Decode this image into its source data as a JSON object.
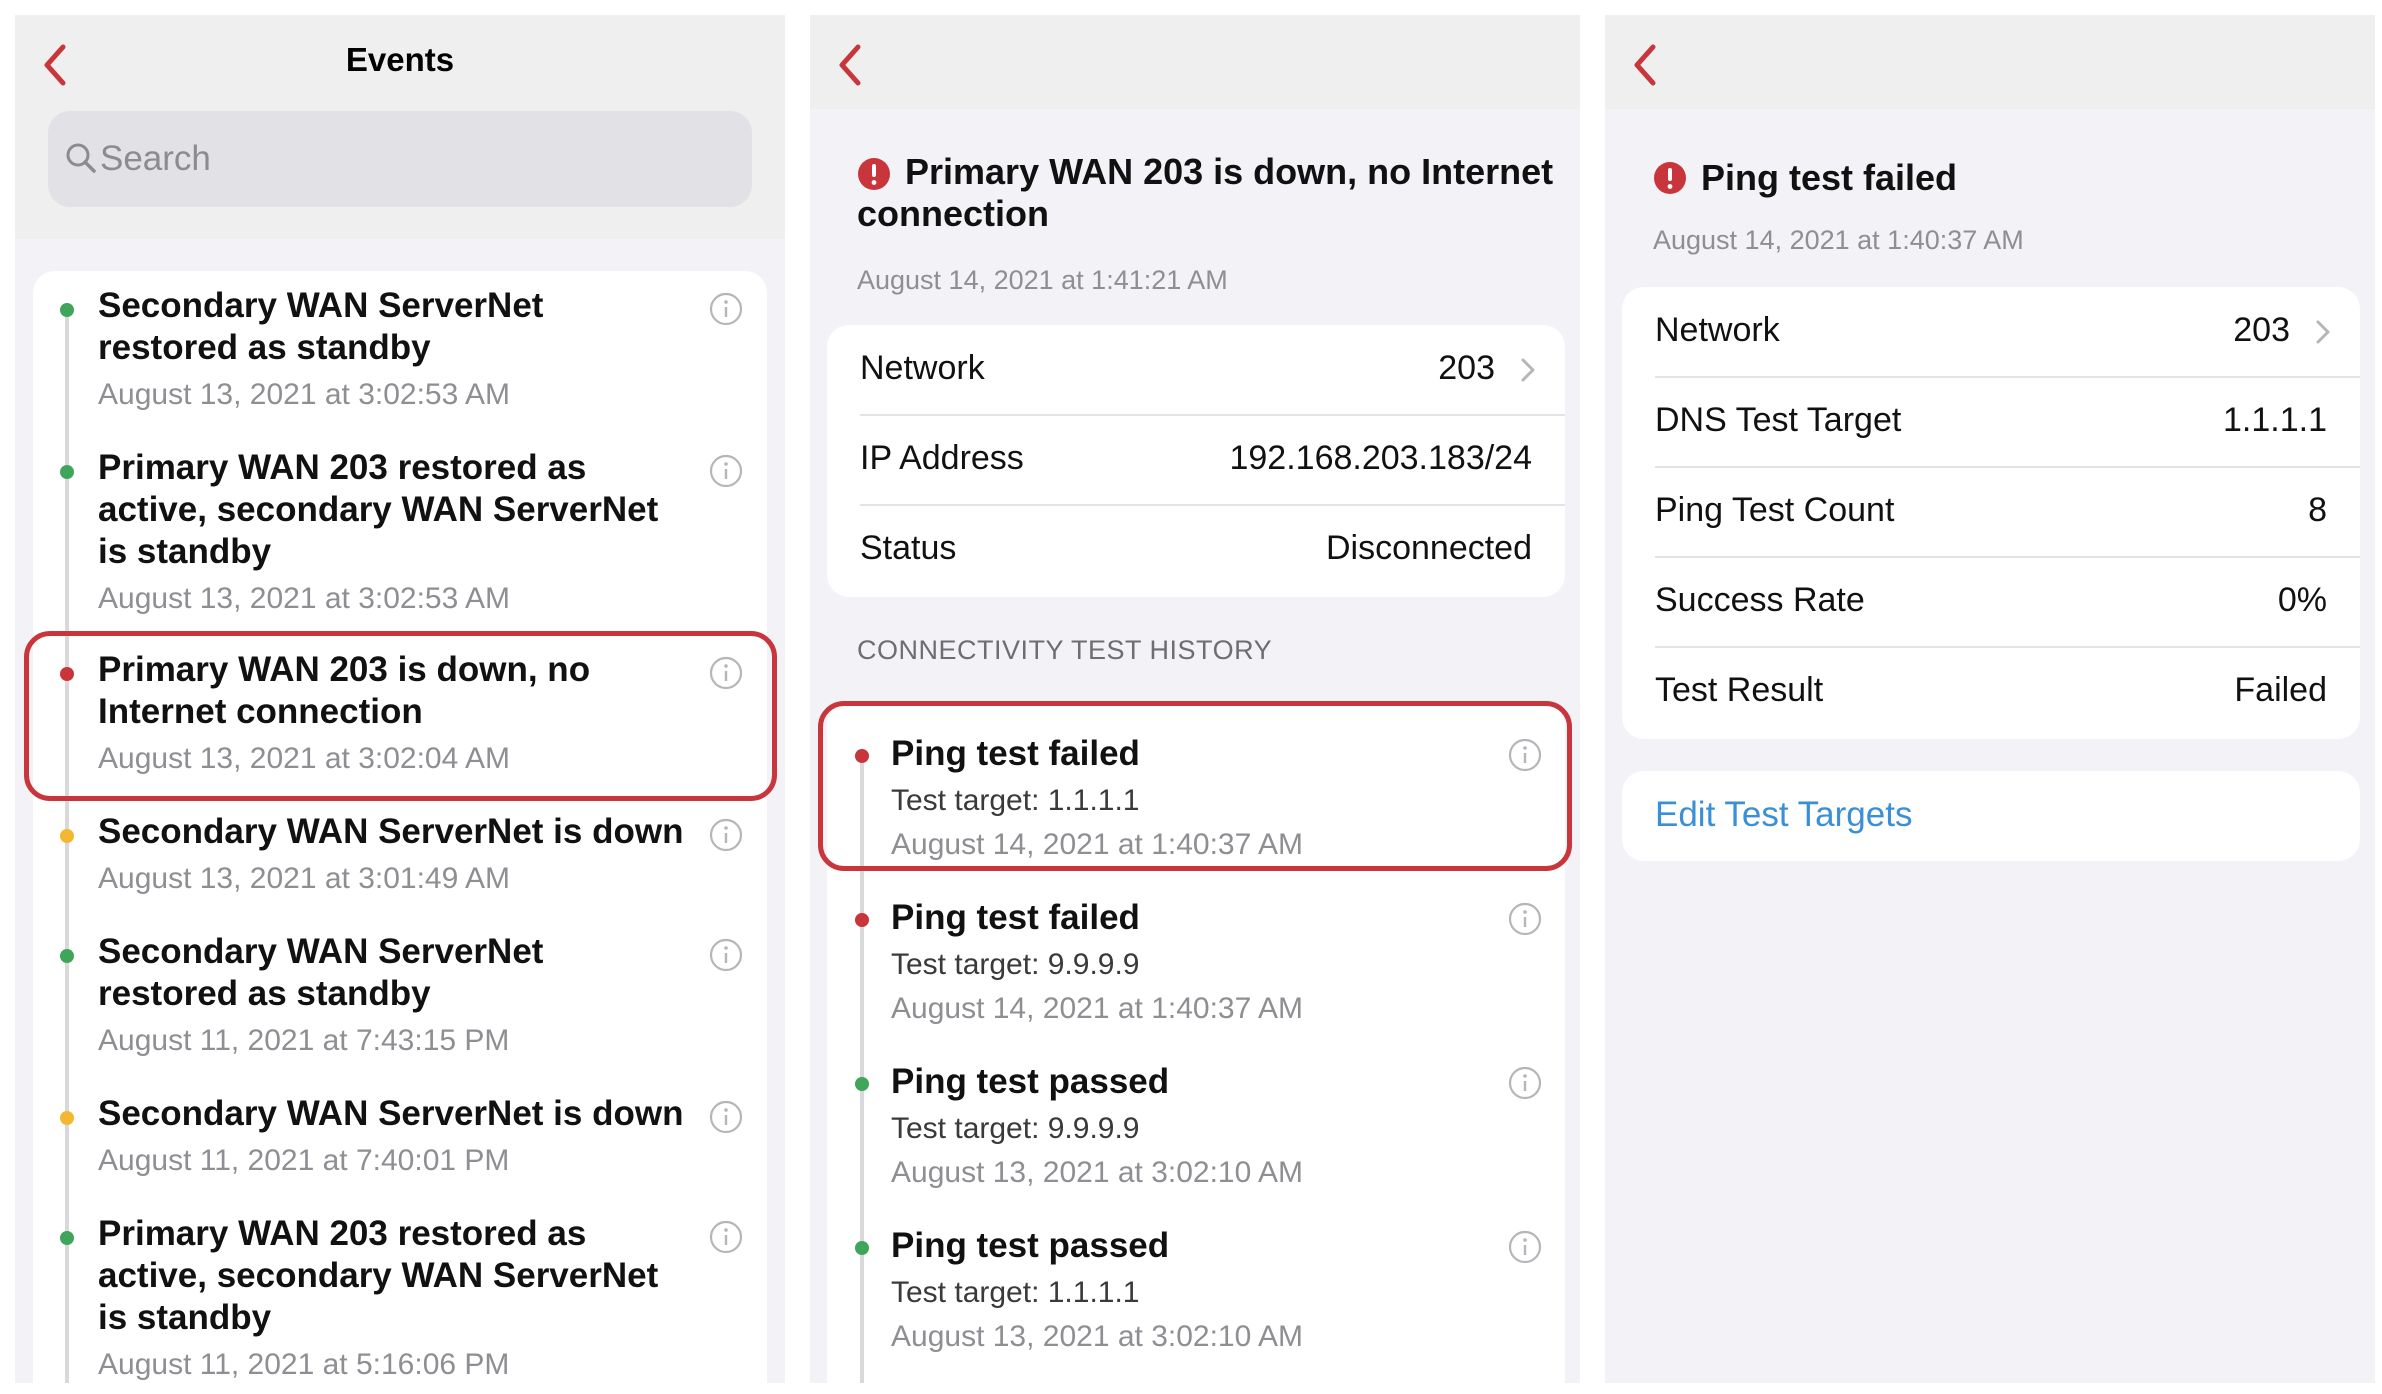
{
  "colors": {
    "accent_red": "#c8353a",
    "green": "#3fa55a",
    "yellow": "#f4b731",
    "link_blue": "#3b8fd6"
  },
  "events_screen": {
    "title": "Events",
    "search_placeholder": "Search",
    "events": [
      {
        "title_line1": "Secondary WAN ServerNet",
        "title_line2": "restored as standby",
        "title_line3": "",
        "time": "August 13, 2021 at 3:02:53 AM",
        "status": "green"
      },
      {
        "title_line1": "Primary WAN 203 restored as",
        "title_line2": "active, secondary WAN ServerNet",
        "title_line3": "is standby",
        "time": "August 13, 2021 at 3:02:53 AM",
        "status": "green"
      },
      {
        "title_line1": "Primary WAN 203 is down, no",
        "title_line2": "Internet connection",
        "title_line3": "",
        "time": "August 13, 2021 at 3:02:04 AM",
        "status": "red",
        "highlighted": true
      },
      {
        "title_line1": "Secondary WAN ServerNet is down",
        "title_line2": "",
        "title_line3": "",
        "time": "August 13, 2021 at 3:01:49 AM",
        "status": "yellow"
      },
      {
        "title_line1": "Secondary WAN ServerNet",
        "title_line2": "restored as standby",
        "title_line3": "",
        "time": "August 11, 2021 at 7:43:15 PM",
        "status": "green"
      },
      {
        "title_line1": "Secondary WAN ServerNet is down",
        "title_line2": "",
        "title_line3": "",
        "time": "August 11, 2021 at 7:40:01 PM",
        "status": "yellow"
      },
      {
        "title_line1": "Primary WAN 203 restored as",
        "title_line2": "active, secondary WAN ServerNet",
        "title_line3": "is standby",
        "time": "August 11, 2021 at 5:16:06 PM",
        "status": "green"
      }
    ]
  },
  "event_detail": {
    "title_line1": "Primary WAN 203 is down, no Internet",
    "title_line2": "connection",
    "time": "August 14, 2021 at 1:41:21 AM",
    "rows": [
      {
        "label": "Network",
        "value": "203",
        "chevron": true
      },
      {
        "label": "IP Address",
        "value": "192.168.203.183/24"
      },
      {
        "label": "Status",
        "value": "Disconnected"
      }
    ],
    "history_header": "CONNECTIVITY TEST HISTORY",
    "history": [
      {
        "title": "Ping test failed",
        "target": "Test target: 1.1.1.1",
        "time": "August 14, 2021 at 1:40:37 AM",
        "status": "red",
        "highlighted": true
      },
      {
        "title": "Ping test failed",
        "target": "Test target:  9.9.9.9",
        "time": "August 14, 2021 at 1:40:37 AM",
        "status": "red"
      },
      {
        "title": "Ping test passed",
        "target": "Test target:  9.9.9.9",
        "time": "August 13, 2021 at 3:02:10 AM",
        "status": "green"
      },
      {
        "title": "Ping test passed",
        "target": "Test target:  1.1.1.1",
        "time": "August 13, 2021 at 3:02:10 AM",
        "status": "green"
      }
    ]
  },
  "test_detail": {
    "title": "Ping test failed",
    "time": "August 14, 2021 at 1:40:37 AM",
    "rows": [
      {
        "label": "Network",
        "value": "203",
        "chevron": true
      },
      {
        "label": "DNS Test Target",
        "value": "1.1.1.1"
      },
      {
        "label": "Ping Test Count",
        "value": "8"
      },
      {
        "label": "Success Rate",
        "value": "0%"
      },
      {
        "label": "Test Result",
        "value": "Failed"
      }
    ],
    "edit_link": "Edit Test Targets"
  }
}
